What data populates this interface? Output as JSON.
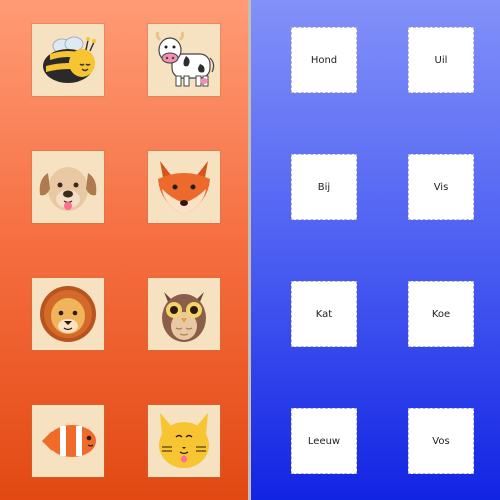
{
  "animals": [
    {
      "name": "bee"
    },
    {
      "name": "cow"
    },
    {
      "name": "dog"
    },
    {
      "name": "fox"
    },
    {
      "name": "lion"
    },
    {
      "name": "owl"
    },
    {
      "name": "fish"
    },
    {
      "name": "cat"
    }
  ],
  "words": [
    "Hond",
    "Uil",
    "Bij",
    "Vis",
    "Kat",
    "Koe",
    "Leeuw",
    "Vos"
  ],
  "colors": {
    "left_panel_top": "#ff9b76",
    "left_panel_bottom": "#e24913",
    "right_panel_top": "#8391f9",
    "right_panel_bottom": "#1224e3",
    "card_bg": "#f6e2c1"
  }
}
